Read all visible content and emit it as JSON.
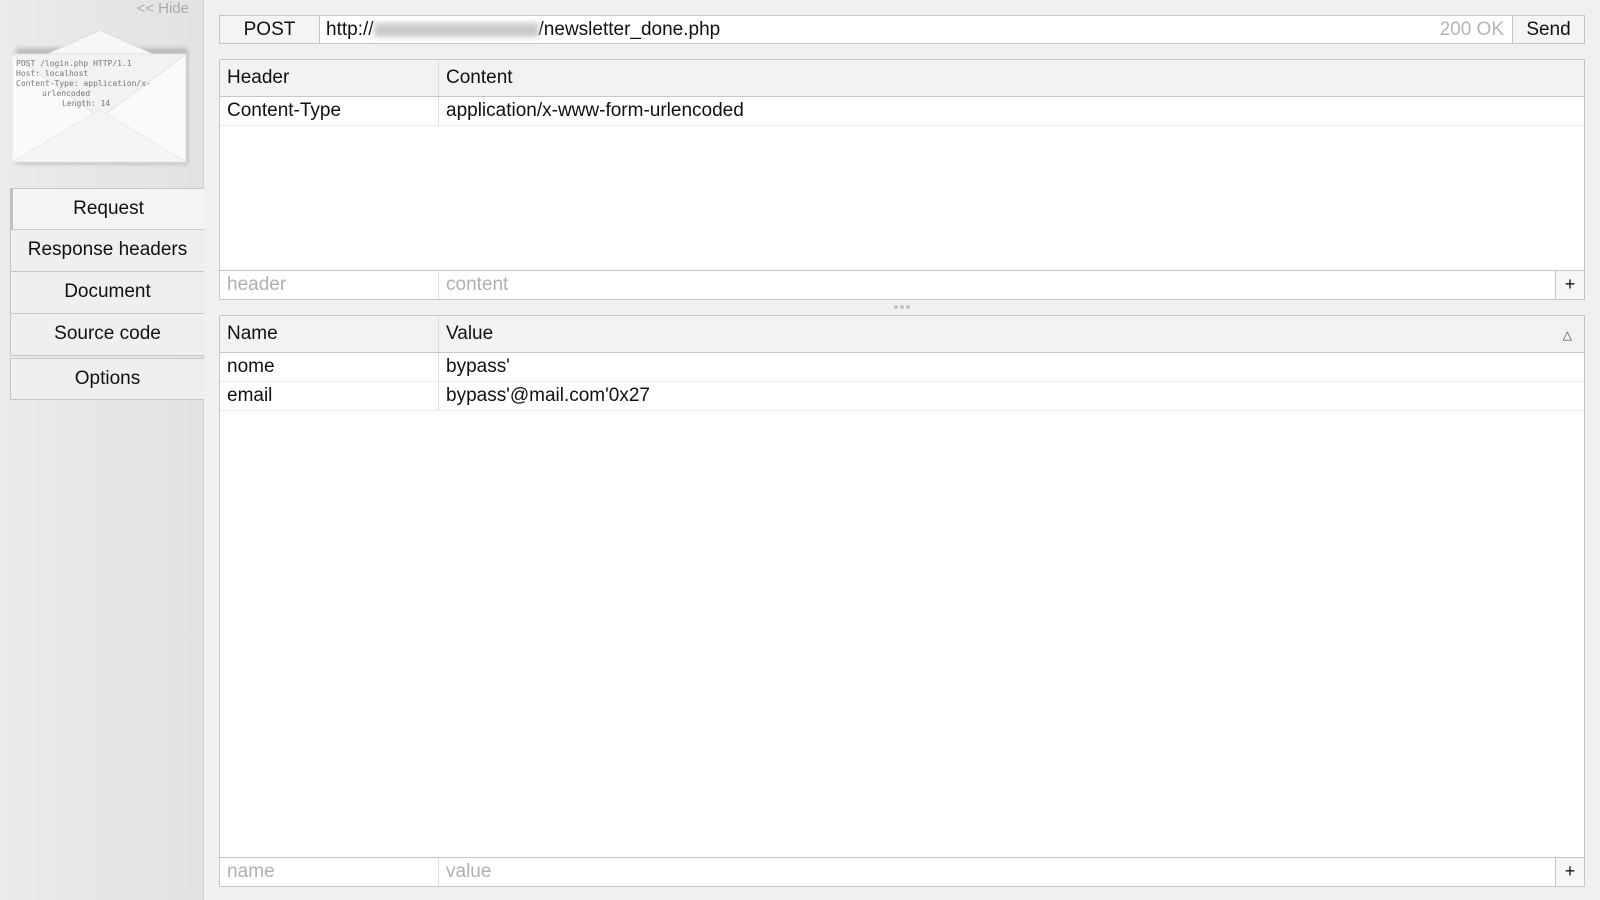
{
  "sidebar": {
    "hide_label": "<< Hide",
    "logo_lines": [
      "POST /login.php HTTP/1.1",
      "Host: localhost",
      "Content-Type: application/x-",
      "urlencoded",
      "Length: 14"
    ],
    "nav": [
      {
        "label": "Request"
      },
      {
        "label": "Response headers"
      },
      {
        "label": "Document"
      },
      {
        "label": "Source code"
      },
      {
        "label": "Options"
      }
    ]
  },
  "request": {
    "method": "POST",
    "url_prefix": "http://",
    "url_suffix": "/newsletter_done.php",
    "status": "200 OK",
    "send_label": "Send"
  },
  "headers_table": {
    "col_header": "Header",
    "col_content": "Content",
    "rows": [
      {
        "name": "Content-Type",
        "value": "application/x-www-form-urlencoded"
      }
    ],
    "placeholder_name": "header",
    "placeholder_value": "content",
    "add_label": "+"
  },
  "params_table": {
    "col_name": "Name",
    "col_value": "Value",
    "sort_icon": "△",
    "rows": [
      {
        "name": "nome",
        "value": "bypass'"
      },
      {
        "name": "email",
        "value": "bypass'@mail.com'0x27"
      }
    ],
    "placeholder_name": "name",
    "placeholder_value": "value",
    "add_label": "+"
  }
}
